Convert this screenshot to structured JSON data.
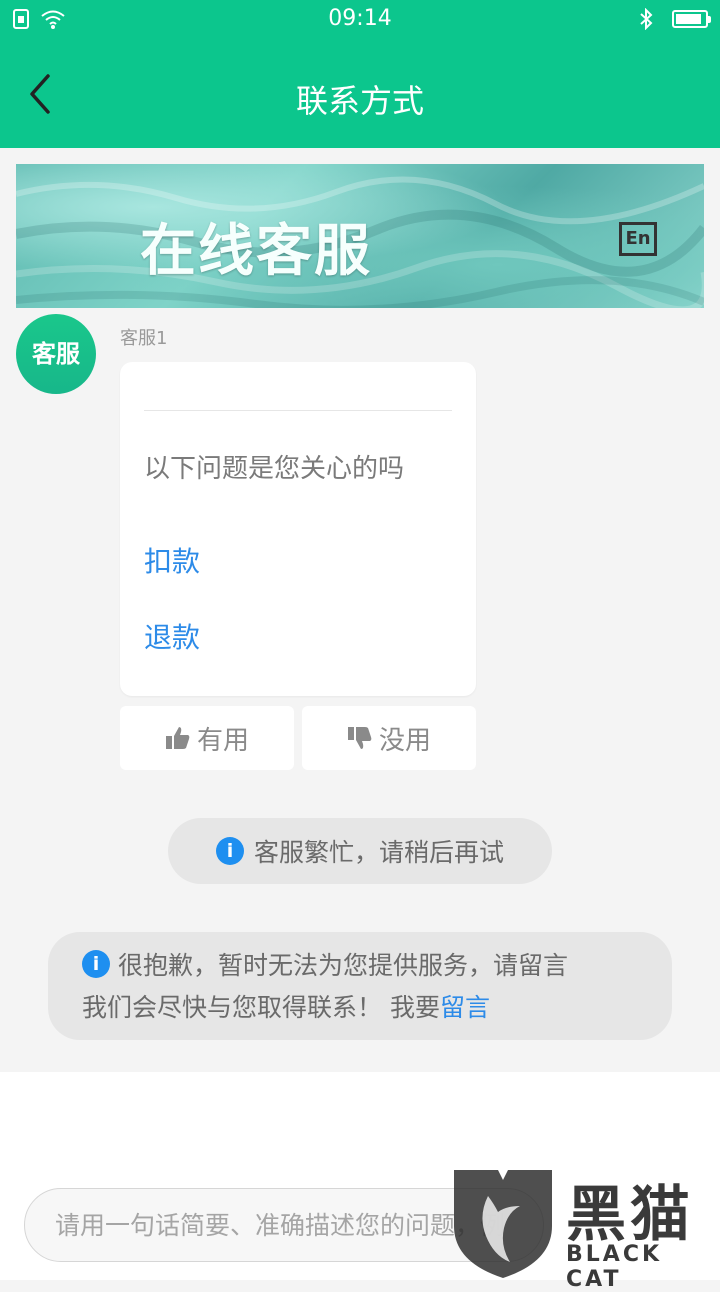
{
  "status_bar": {
    "time": "09:14",
    "icons": [
      "sim-icon",
      "wifi-icon",
      "bluetooth-icon",
      "battery-icon"
    ],
    "battery_level": 0.78
  },
  "header": {
    "title": "联系方式",
    "back_icon": "chevron-left-icon"
  },
  "banner": {
    "title": "在线客服",
    "lang_button": "En"
  },
  "chat": {
    "avatar_label": "客服",
    "agent_name": "客服1",
    "question": "以下问题是您关心的吗",
    "options": [
      "扣款",
      "退款"
    ],
    "feedback": {
      "useful": "有用",
      "useless": "没用"
    }
  },
  "notices": {
    "busy": "客服繁忙，请稍后再试",
    "apology_line1": "很抱歉，暂时无法为您提供服务，请留言",
    "apology_line2": "我们会尽快与您取得联系！ 我要",
    "leave_message_link": "留言"
  },
  "input": {
    "placeholder": "请用一句话简要、准确描述您的问题，例"
  },
  "watermark": {
    "brand": "黑猫",
    "brand_en": "BLACK CAT"
  },
  "colors": {
    "primary": "#0cc68d",
    "link": "#2d8be8",
    "info": "#1e8ff0"
  }
}
